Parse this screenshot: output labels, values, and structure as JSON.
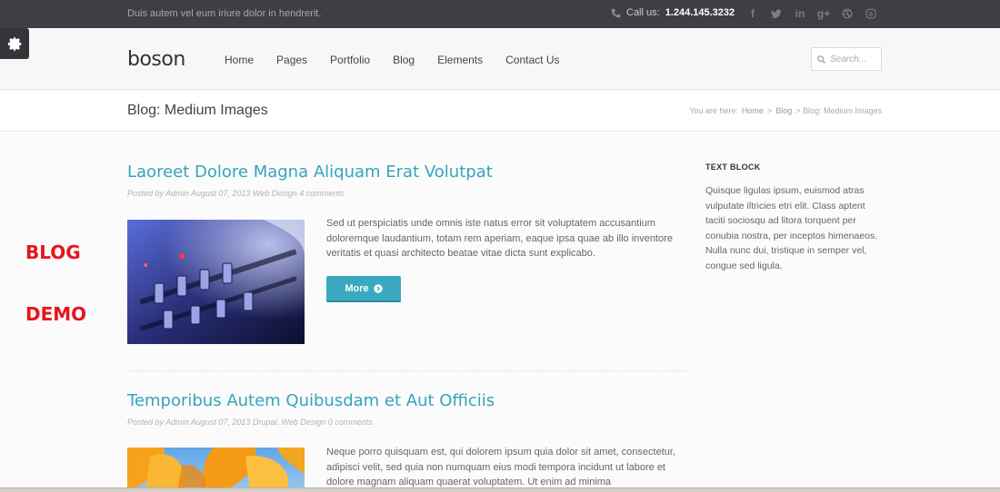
{
  "topbar": {
    "tagline": "Duis autem vel eum iriure dolor in hendrerit.",
    "call_label": "Call us:",
    "phone": "1.244.145.3232",
    "socials": [
      "facebook-icon",
      "twitter-icon",
      "linkedin-icon",
      "googleplus-icon",
      "dribbble-icon",
      "skype-icon"
    ]
  },
  "header": {
    "logo": "boson",
    "nav": [
      "Home",
      "Pages",
      "Portfolio",
      "Blog",
      "Elements",
      "Contact Us"
    ],
    "search_placeholder": "Search..."
  },
  "page": {
    "title": "Blog: Medium Images",
    "breadcrumb": {
      "prefix": "You are here:",
      "items": [
        "Home",
        ">",
        "Blog",
        "> Blog: Medium Images"
      ]
    }
  },
  "posts": [
    {
      "title": "Laoreet Dolore Magna Aliquam Erat Volutpat",
      "meta": "Posted by Admin August 07, 2013 Web Design 4 comments",
      "excerpt": "Sed ut perspiciatis unde omnis iste natus error sit voluptatem accusantium doloremque laudantium, totam rem aperiam, eaque ipsa quae ab illo inventore veritatis et quasi architecto beatae vitae dicta sunt explicabo.",
      "more_label": "More"
    },
    {
      "title": "Temporibus Autem Quibusdam et Aut Officiis",
      "meta": "Posted by Admin August 07, 2013 Drupal, Web Design 0 comments",
      "excerpt": "Neque porro quisquam est, qui dolorem ipsum quia dolor sit amet, consectetur, adipisci velit, sed quia non numquam eius modi tempora incidunt ut labore et dolore magnam aliquam quaerat voluptatem. Ut enim ad minima"
    }
  ],
  "sidebar": {
    "title": "TEXT BLOCK",
    "text": "Quisque ligulas ipsum, euismod atras vulputate iltricies etri elit. Class aptent taciti sociosqu ad litora torquent per conubia nostra, per inceptos himenaeos. Nulla nunc dui, tristique in semper vel, congue sed ligula."
  },
  "overlay": {
    "line1": "BLOG",
    "line2": "DEMO"
  },
  "colors": {
    "accent": "#35a4bd",
    "topbar": "#3d3f43",
    "overlay_red": "#e8141c"
  }
}
